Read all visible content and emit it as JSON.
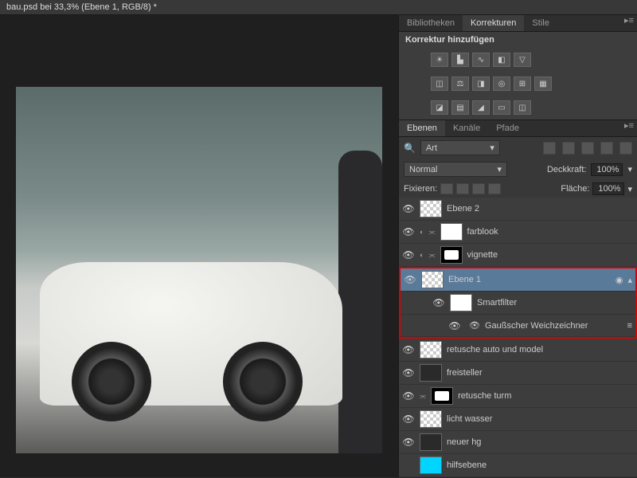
{
  "titlebar": "bau.psd bei 33,3% (Ebene 1, RGB/8) *",
  "topTabs": [
    "Bibliotheken",
    "Korrekturen",
    "Stile"
  ],
  "topTabActive": 1,
  "corrections": {
    "header": "Korrektur hinzufügen"
  },
  "layerTabs": [
    "Ebenen",
    "Kanäle",
    "Pfade"
  ],
  "layerTabActive": 0,
  "filterKind": "Art",
  "blend": {
    "mode": "Normal",
    "opacityLabel": "Deckkraft:",
    "opacityValue": "100%"
  },
  "lock": {
    "label": "Fixieren:",
    "fillLabel": "Fläche:",
    "fillValue": "100%"
  },
  "layers": [
    {
      "name": "Ebene 2",
      "thumb": "checker",
      "visible": true
    },
    {
      "name": "farblook",
      "thumb": "white",
      "visible": true,
      "hasMask": true,
      "hasAdjust": true
    },
    {
      "name": "vignette",
      "thumb": "masked",
      "visible": true,
      "hasMask": true,
      "hasAdjust": true
    },
    {
      "name": "Ebene 1",
      "thumb": "checker",
      "visible": true,
      "selected": true,
      "smartObj": true
    },
    {
      "name": "Smartfilter",
      "thumb": "white",
      "visible": true,
      "sub": true
    },
    {
      "name": "Gaußscher Weichzeichner",
      "visible": true,
      "subsub": true,
      "filterItem": true
    },
    {
      "name": "retusche auto und model",
      "thumb": "checker",
      "visible": true
    },
    {
      "name": "freisteller",
      "thumb": "dark",
      "visible": true
    },
    {
      "name": "retusche turm",
      "thumb": "masked",
      "visible": true,
      "hasMask": true
    },
    {
      "name": "licht wasser",
      "thumb": "checker",
      "visible": true
    },
    {
      "name": "neuer hg",
      "thumb": "dark",
      "visible": true
    },
    {
      "name": "hilfsebene",
      "thumb": "cyan",
      "visible": false
    }
  ]
}
